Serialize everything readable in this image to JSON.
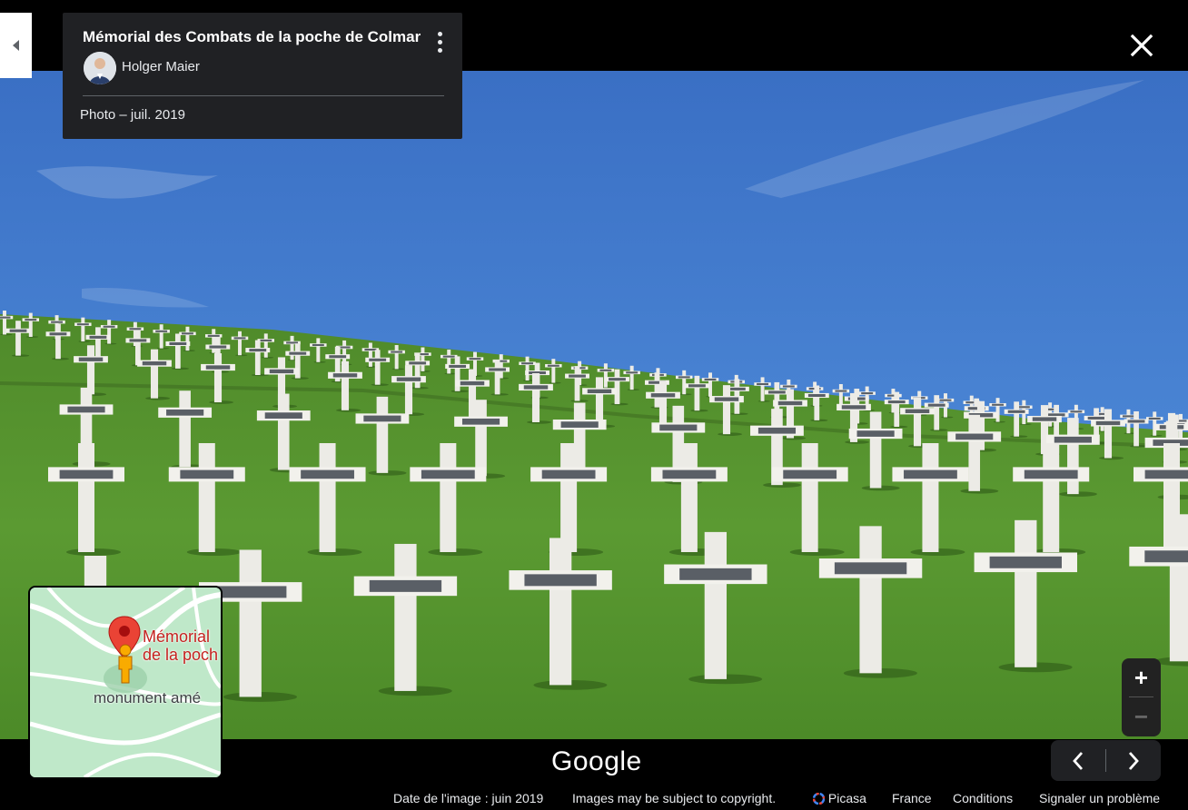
{
  "info_card": {
    "title": "Mémorial des Combats de la poche de Colmar",
    "author": "Holger Maier",
    "photo_date": "Photo – juil. 2019"
  },
  "minimap": {
    "place_label_line1": "Mémorial",
    "place_label_line2": "de la poch",
    "nearby_label": "monument amé"
  },
  "zoom": {
    "in_label": "+",
    "out_label": "−"
  },
  "brand": "Google",
  "footer": {
    "image_date": "Date de l'image : juin 2019",
    "copyright": "Images may be subject to copyright.",
    "provider": "Picasa",
    "country": "France",
    "terms": "Conditions",
    "report": "Signaler un problème"
  },
  "icons": {
    "collapse": "triangle-left-icon",
    "menu": "more-vert-icon",
    "close": "close-icon",
    "pegman": "pegman-icon",
    "pin": "place-pin-icon",
    "prev": "chevron-left-icon",
    "next": "chevron-right-icon"
  },
  "colors": {
    "card_bg": "#202124",
    "pin_red": "#ea4335",
    "map_green": "#bfe8c9",
    "pegman_yellow": "#f9ab00"
  }
}
